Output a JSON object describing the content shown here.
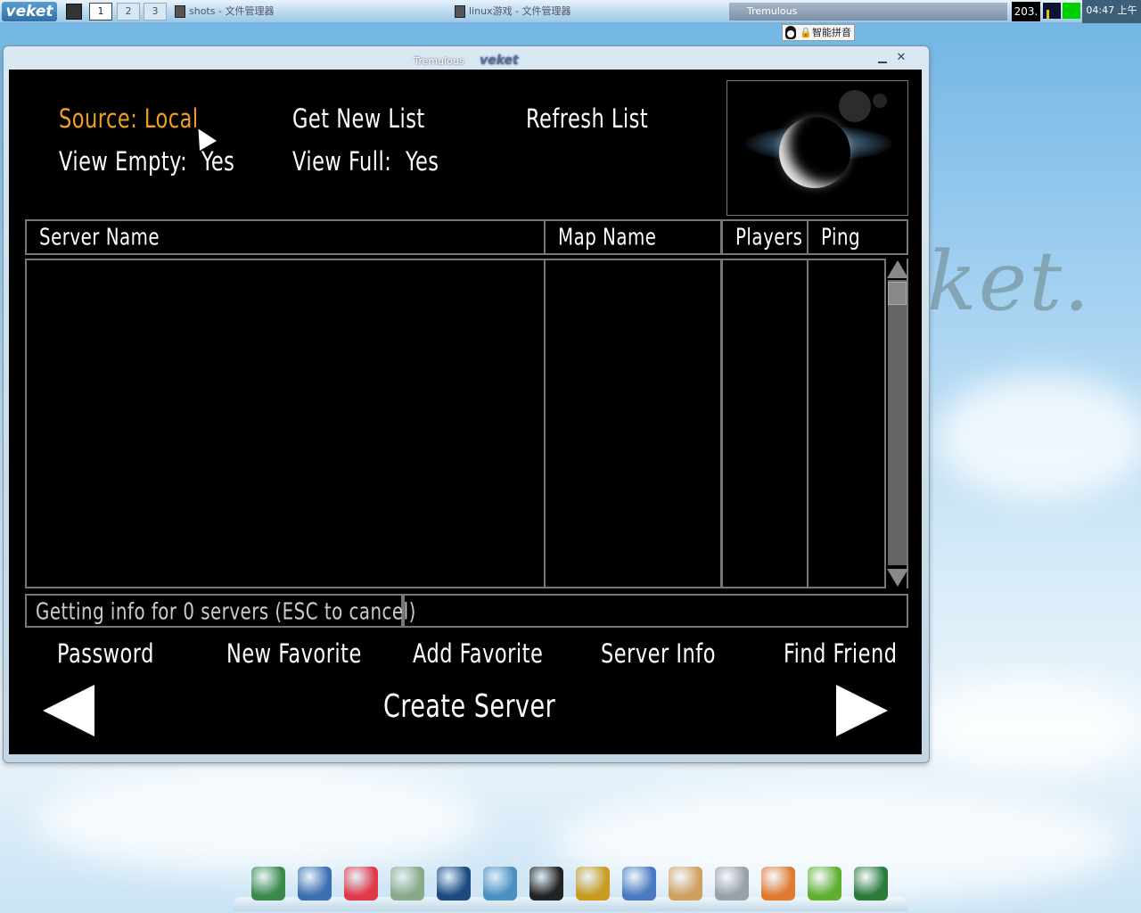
{
  "taskbar": {
    "logo": "veket",
    "workspaces": [
      "1",
      "2",
      "3"
    ],
    "tasks": [
      {
        "label": "shots - 文件管理器"
      },
      {
        "label": "linux游戏 - 文件管理器"
      },
      {
        "label": "Tremulous"
      }
    ],
    "tray_number": "203.",
    "clock": "04:47 上午"
  },
  "ime": {
    "lock": "🔒",
    "label": "智能拼音"
  },
  "desktop": {
    "logo_text": "ket."
  },
  "window": {
    "title": "Tremulous",
    "brand": "veket",
    "minimize": "–",
    "close": "✕"
  },
  "menu": {
    "source": "Source: Local",
    "get_new_list": "Get New List",
    "refresh_list": "Refresh List",
    "view_empty_label": "View Empty:",
    "view_empty_value": "Yes",
    "view_full_label": "View Full:",
    "view_full_value": "Yes"
  },
  "table": {
    "columns": [
      "Server Name",
      "Map Name",
      "Players",
      "Ping"
    ],
    "rows": []
  },
  "status": {
    "message": "Getting info for 0 servers (ESC to cancel)",
    "detail": ""
  },
  "actions": {
    "password": "Password",
    "new_favorite": "New Favorite",
    "add_favorite": "Add Favorite",
    "server_info": "Server Info",
    "find_friend": "Find Friend",
    "create_server": "Create Server"
  },
  "dock": {
    "icons": [
      {
        "name": "file-manager-icon",
        "color": "#3a8a4a"
      },
      {
        "name": "monitor-icon",
        "color": "#3a6fb0"
      },
      {
        "name": "pig-icon",
        "color": "#e03a4a"
      },
      {
        "name": "editor-icon",
        "color": "#88aa88"
      },
      {
        "name": "media-player-icon",
        "color": "#1a4a80"
      },
      {
        "name": "network-icon",
        "color": "#4a90c0"
      },
      {
        "name": "penguin-icon",
        "color": "#222222"
      },
      {
        "name": "door-icon",
        "color": "#c89a20"
      },
      {
        "name": "windows-icon",
        "color": "#4a7ac0"
      },
      {
        "name": "paint-icon",
        "color": "#d0a060"
      },
      {
        "name": "usb-drive-icon",
        "color": "#9aa0a8"
      },
      {
        "name": "photo-icon",
        "color": "#e07a30"
      },
      {
        "name": "help-icon",
        "color": "#60b030"
      },
      {
        "name": "camera-icon",
        "color": "#2a7a3a"
      }
    ]
  }
}
